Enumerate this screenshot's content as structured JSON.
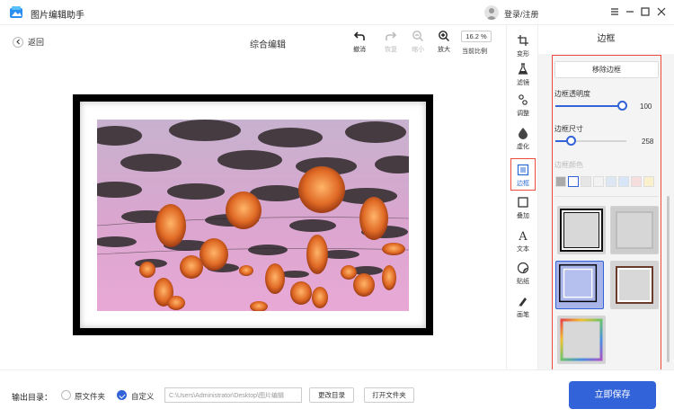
{
  "app": {
    "title": "图片编辑助手"
  },
  "header": {
    "login_label": "登录/注册"
  },
  "toolbar": {
    "back_label": "返回",
    "title": "综合编辑",
    "undo_label": "撤消",
    "redo_label": "恢复",
    "zoom_out_label": "缩小",
    "zoom_in_label": "放大",
    "zoom_value": "16.2 %",
    "zoom_caption": "当前比例"
  },
  "sidebar": {
    "items": [
      {
        "label": "变形",
        "icon": "crop-icon"
      },
      {
        "label": "滤镜",
        "icon": "flask-icon"
      },
      {
        "label": "调整",
        "icon": "adjust-icon"
      },
      {
        "label": "虚化",
        "icon": "drop-icon"
      },
      {
        "label": "边框",
        "icon": "frame-icon"
      },
      {
        "label": "叠加",
        "icon": "overlay-icon"
      },
      {
        "label": "文本",
        "icon": "text-icon"
      },
      {
        "label": "贴纸",
        "icon": "sticker-icon"
      },
      {
        "label": "画笔",
        "icon": "brush-icon"
      }
    ],
    "active": "边框"
  },
  "panel": {
    "title": "边框",
    "remove_label": "移除边框",
    "opacity_label": "边框透明度",
    "opacity_value": "100",
    "opacity_fraction": 1.0,
    "size_label": "边框尺寸",
    "size_value": "258",
    "size_fraction": 0.12,
    "color_label": "边框颜色",
    "colors": [
      "#aaaaaa",
      "#ffffff",
      "#e6e6e6",
      "#f2f2f2",
      "#dde6f3",
      "#d6e6f7",
      "#f6dede",
      "#f8e2d6",
      "#faf0cc"
    ]
  },
  "bottom": {
    "output_label": "输出目录：",
    "original_label": "原文件夹",
    "custom_label": "自定义",
    "path_value": "C:\\Users\\Administrator\\Desktop\\图片编辑",
    "change_dir_label": "更改目录",
    "open_folder_label": "打开文件夹",
    "save_label": "立即保存"
  },
  "colors": {
    "accent": "#3363d8",
    "highlight": "#ee4b3c"
  }
}
